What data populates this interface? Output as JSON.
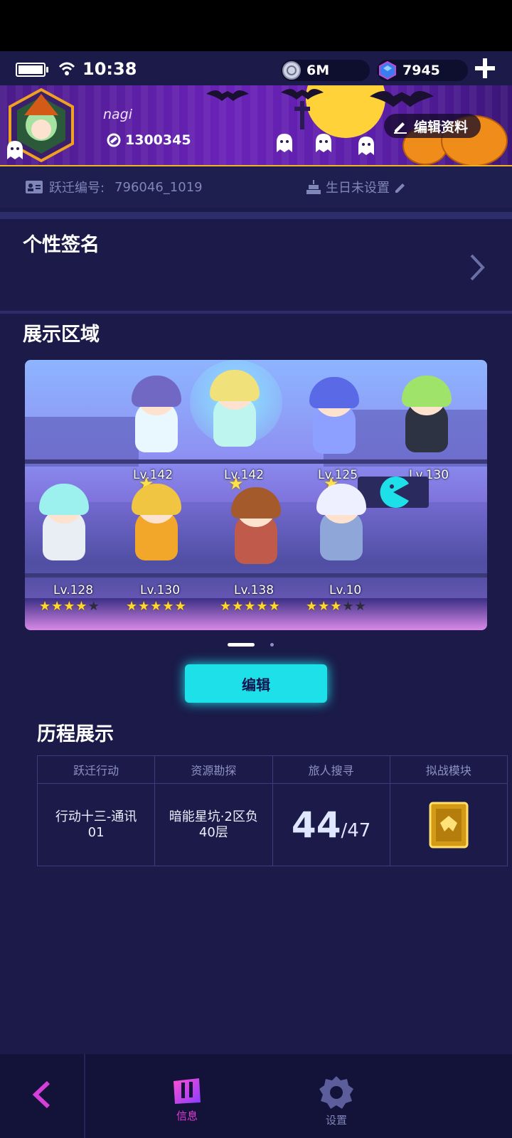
{
  "status_bar": {
    "time": "10:38",
    "coins": "6M",
    "gems": "7945"
  },
  "profile": {
    "username": "nagi",
    "uid": "1300345",
    "edit_profile_label": "编辑资料",
    "jump_id_label": "跃迁编号:",
    "jump_id_value": "796046_1019",
    "birthday_label": "生日未设置"
  },
  "signature": {
    "title": "个性签名"
  },
  "showcase": {
    "title": "展示区域",
    "characters": [
      {
        "level": "Lv.142"
      },
      {
        "level": "Lv.142"
      },
      {
        "level": "Lv.125"
      },
      {
        "level": "Lv.130"
      },
      {
        "level": "Lv.128",
        "stars": 4,
        "max_stars": 5
      },
      {
        "level": "Lv.130",
        "stars": 5,
        "max_stars": 5
      },
      {
        "level": "Lv.138",
        "stars": 5,
        "max_stars": 5
      },
      {
        "level": "Lv.10",
        "stars": 3,
        "max_stars": 5
      }
    ],
    "edit_label": "编辑"
  },
  "history": {
    "title": "历程展示",
    "columns": [
      "跃迁行动",
      "资源勘探",
      "旅人搜寻",
      "拟战模块"
    ],
    "values": {
      "action": "行动十三-通讯01",
      "exploration": "暗能星坑·2区负40层",
      "search_count": "44",
      "search_total": "/47"
    }
  },
  "nav": {
    "info_label": "信息",
    "settings_label": "设置"
  },
  "colors": {
    "accent_cyan": "#1de0e8",
    "background": "#1b1a48",
    "nav_active": "#e23bd9"
  }
}
